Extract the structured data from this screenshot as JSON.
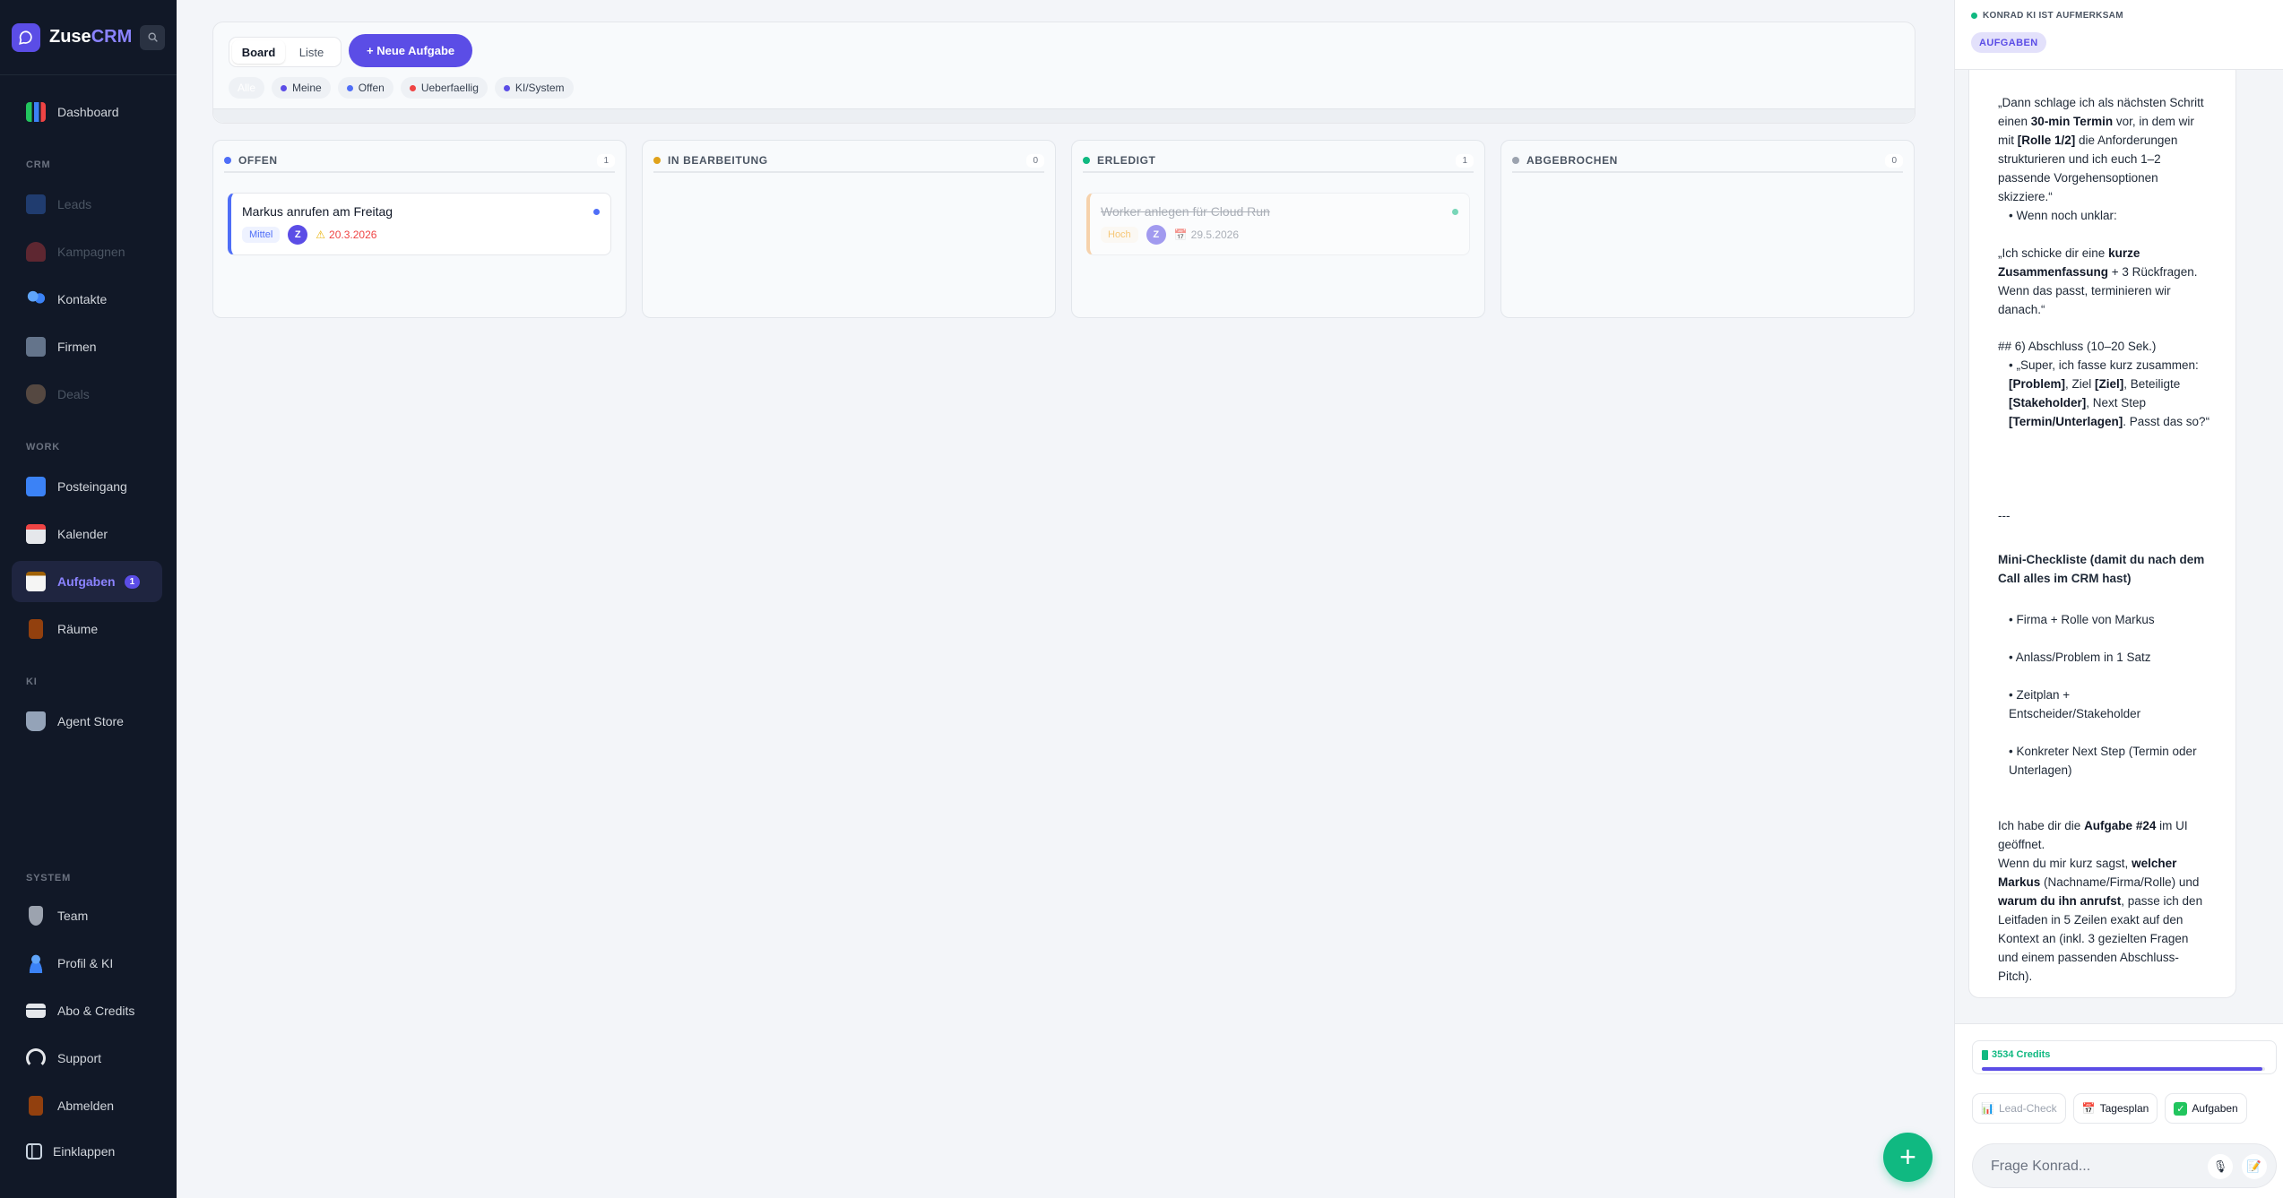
{
  "app": {
    "name_main": "Zuse",
    "name_accent": "CRM"
  },
  "sidebar": {
    "sections": {
      "crm": "CRM",
      "work": "WORK",
      "ki": "KI",
      "system": "SYSTEM"
    },
    "items": {
      "dashboard": "Dashboard",
      "leads": "Leads",
      "kampagnen": "Kampagnen",
      "kontakte": "Kontakte",
      "firmen": "Firmen",
      "deals": "Deals",
      "posteingang": "Posteingang",
      "kalender": "Kalender",
      "aufgaben": "Aufgaben",
      "aufgaben_badge": "1",
      "raeume": "Räume",
      "agent_store": "Agent Store",
      "team": "Team",
      "profil": "Profil & KI",
      "abo": "Abo & Credits",
      "support": "Support",
      "abmelden": "Abmelden",
      "einklappen": "Einklappen"
    }
  },
  "toolbar": {
    "view_board": "Board",
    "view_list": "Liste",
    "new_task": "+ Neue Aufgabe",
    "filters": {
      "alle": "Alle",
      "meine": "Meine",
      "offen": "Offen",
      "ueberfaellig": "Ueberfaellig",
      "ki_system": "KI/System"
    }
  },
  "colors": {
    "accent": "#5b4de6",
    "blue": "#4f6ef7",
    "amber": "#e0a21b",
    "green": "#10b981",
    "gray": "#9ca3af",
    "red": "#ef4444"
  },
  "board": {
    "columns": [
      {
        "title": "OFFEN",
        "count": "1"
      },
      {
        "title": "IN BEARBEITUNG",
        "count": "0"
      },
      {
        "title": "ERLEDIGT",
        "count": "1"
      },
      {
        "title": "ABGEBROCHEN",
        "count": "0"
      }
    ],
    "tasks": {
      "open": {
        "title": "Markus anrufen am Freitag",
        "priority": "Mittel",
        "assignee": "Z",
        "due": "20.3.2026",
        "due_icon": "warning-icon"
      },
      "done": {
        "title": "Worker anlegen für Cloud Run",
        "priority": "Hoch",
        "assignee": "Z",
        "due": "29.5.2026",
        "due_icon": "calendar-icon"
      }
    }
  },
  "assistant": {
    "status": "KONRAD KI IST AUFMERKSAM",
    "context_chip": "AUFGABEN",
    "message": {
      "p1_a": "„Dann schlage ich als nächsten Schritt einen ",
      "p1_b": "30-min Termin",
      "p1_c": " vor, in dem wir mit ",
      "p1_d": "[Rolle 1/2]",
      "p1_e": " die Anforderungen strukturieren und ich euch 1–2 passende Vorgehensoptionen skizziere.“",
      "b1": "• Wenn noch unklar:",
      "p2_a": "„Ich schicke dir eine ",
      "p2_b": "kurze Zusammenfassung",
      "p2_c": " + 3 Rückfragen. Wenn das passt, terminieren wir danach.“",
      "h6": "## 6) Abschluss (10–20 Sek.)",
      "b2_a": "• „Super, ich fasse kurz zusammen: ",
      "b2_b": "[Problem]",
      "b2_c": ", Ziel ",
      "b2_d": "[Ziel]",
      "b2_e": ", Beteiligte ",
      "b2_f": "[Stakeholder]",
      "b2_g": ", Next Step ",
      "b2_h": "[Termin/Unterlagen]",
      "b2_i": ". Passt das so?“",
      "sep": "---",
      "checklist_title": "Mini-Checkliste (damit du nach dem Call alles im CRM hast)",
      "c1": "• Firma + Rolle von Markus",
      "c2": "• Anlass/Problem in 1 Satz",
      "c3": "• Zeitplan + Entscheider/Stakeholder",
      "c4": "• Konkreter Next Step (Termin oder Unterlagen)",
      "f_a": "Ich habe dir die ",
      "f_b": "Aufgabe #24",
      "f_c": " im UI geöffnet.",
      "f_d": "Wenn du mir kurz sagst, ",
      "f_e": "welcher Markus",
      "f_f": " (Nachname/Firma/Rolle) und ",
      "f_g": "warum du ihn anrufst",
      "f_h": ", passe ich den Leitfaden in 5 Zeilen exakt auf den Kontext an (inkl. 3 gezielten Fragen und einem passenden Abschluss-Pitch)."
    },
    "credits": "3534 Credits",
    "credits_fraction": 0.99,
    "quick_actions": {
      "lead_check": "Lead-Check",
      "tagesplan": "Tagesplan",
      "aufgaben": "Aufgaben"
    },
    "input_placeholder": "Frage Konrad..."
  }
}
